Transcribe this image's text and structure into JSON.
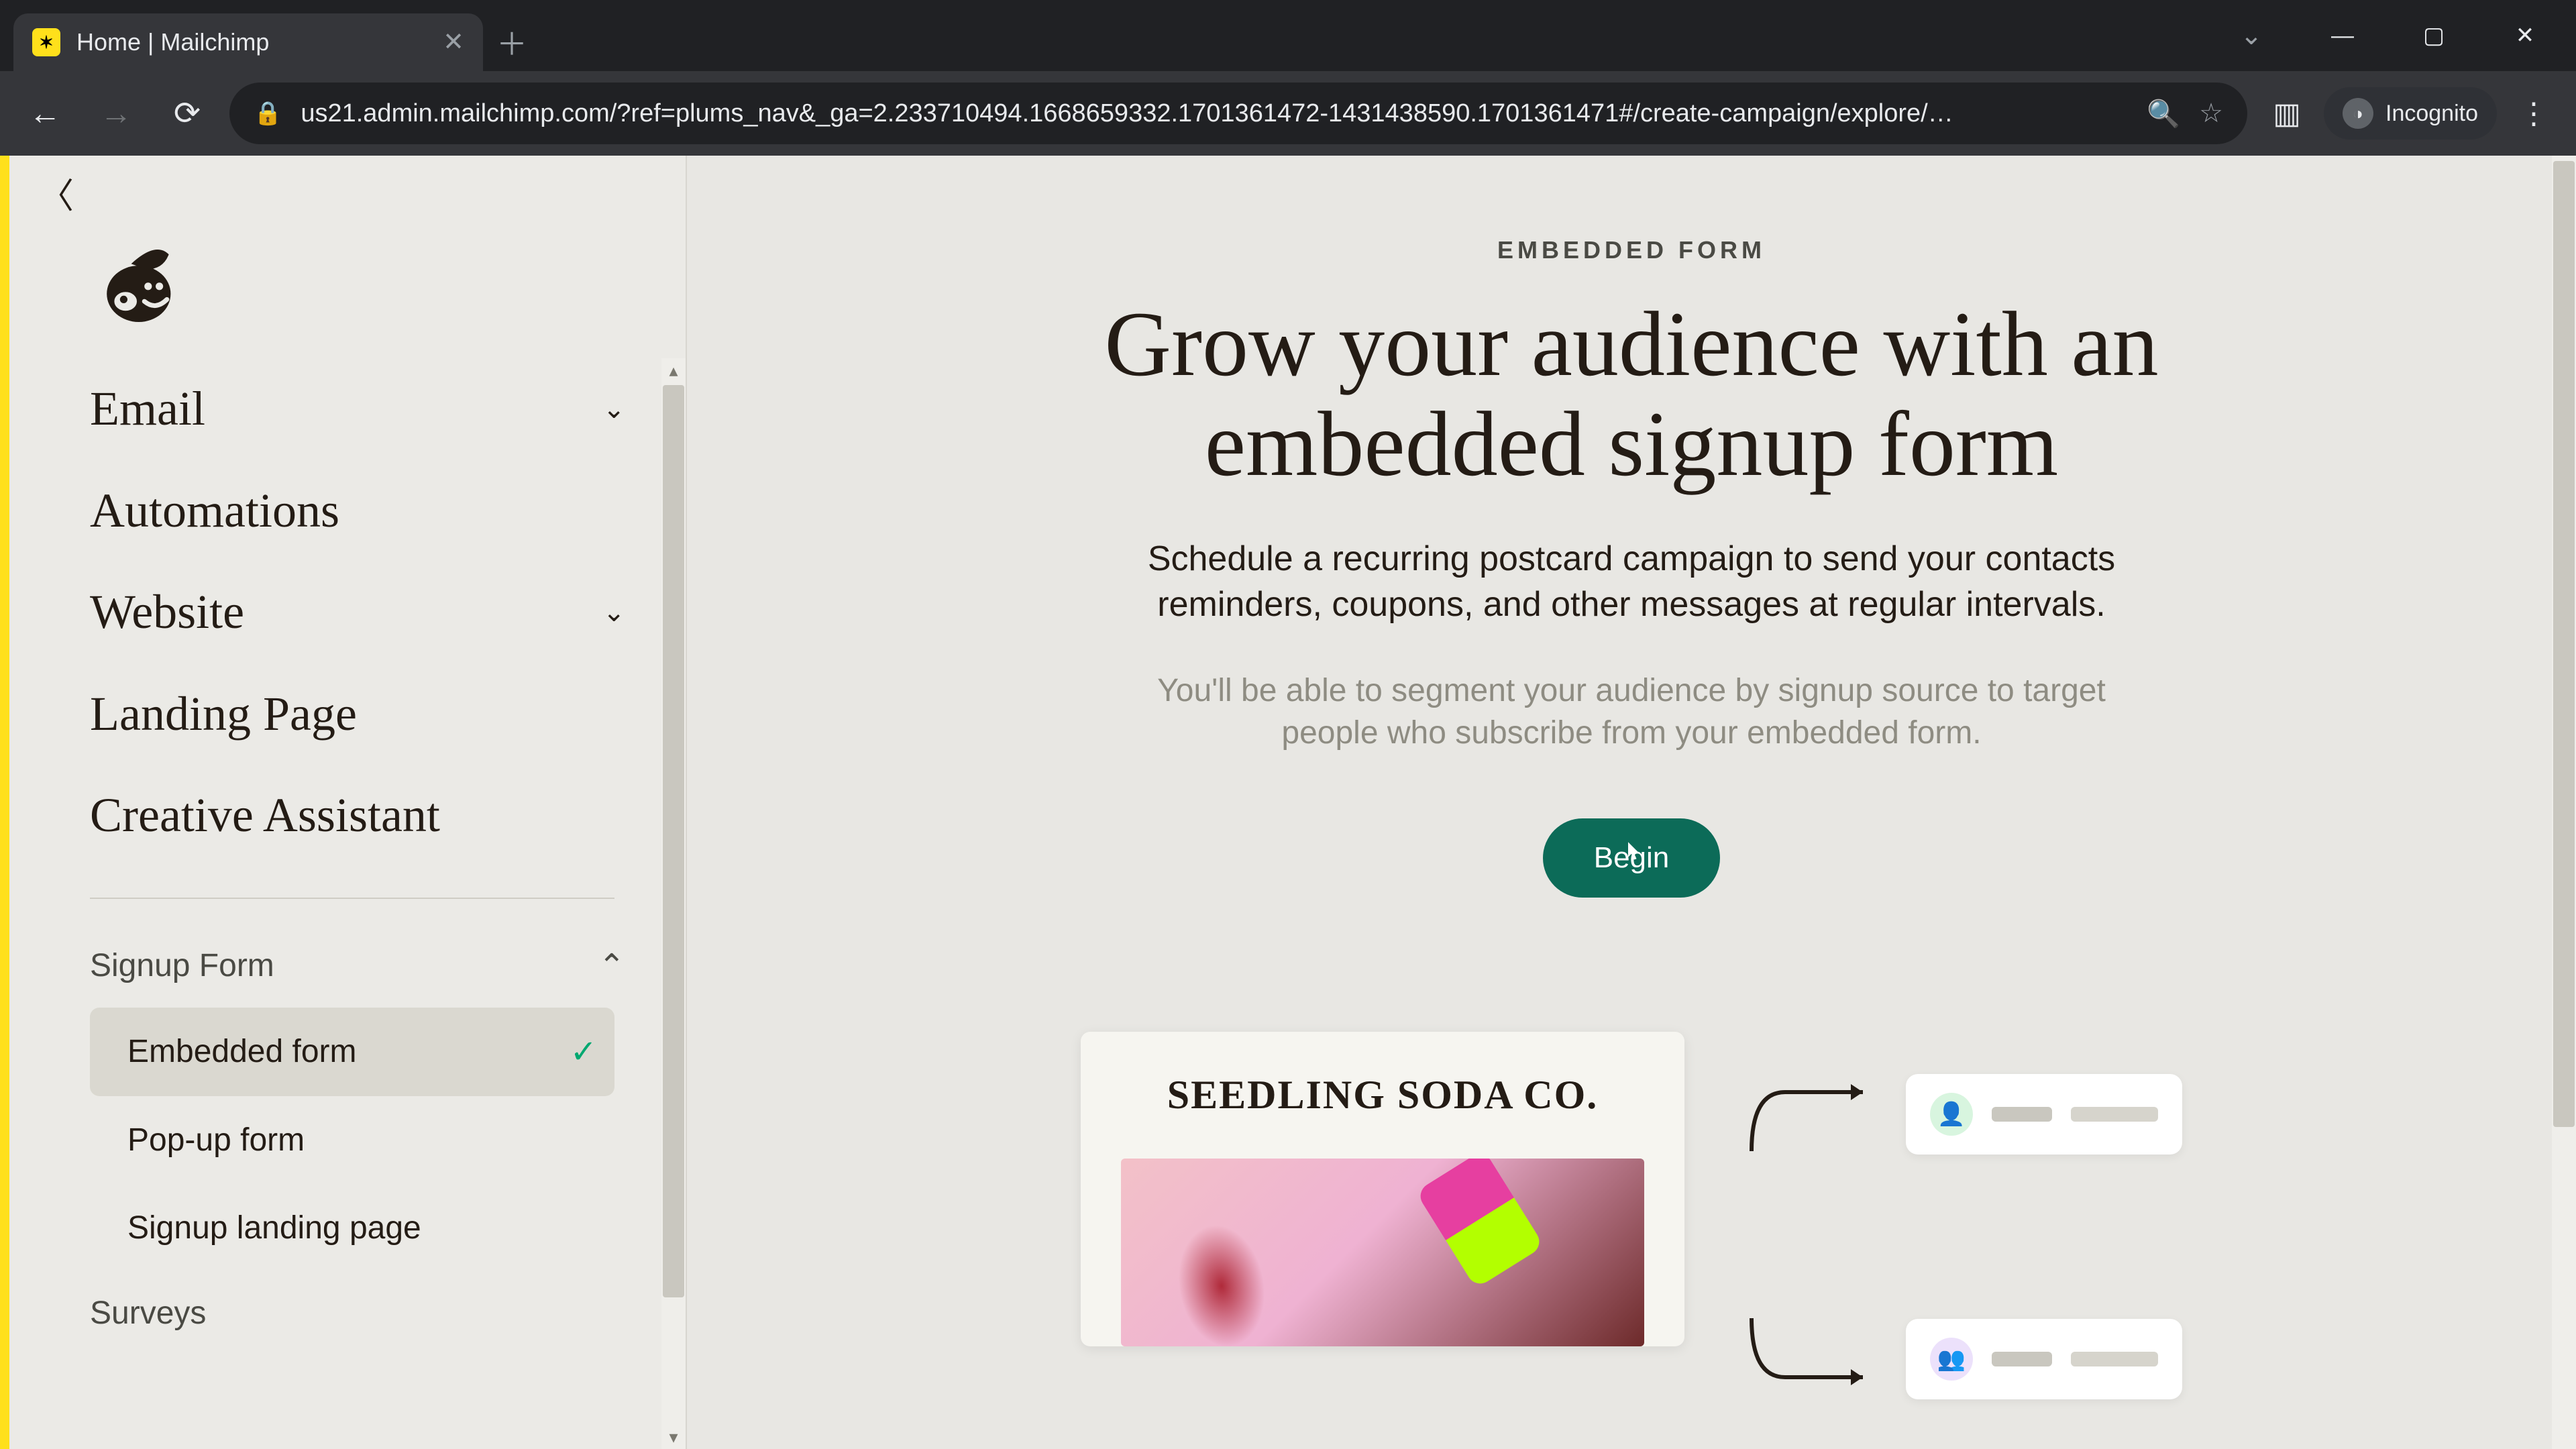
{
  "browser": {
    "tab_title": "Home | Mailchimp",
    "url": "us21.admin.mailchimp.com/?ref=plums_nav&_ga=2.233710494.1668659332.1701361472-1431438590.1701361471#/create-campaign/explore/…",
    "incognito_label": "Incognito"
  },
  "sidebar": {
    "primary": [
      {
        "label": "Email",
        "expandable": true
      },
      {
        "label": "Automations",
        "expandable": false
      },
      {
        "label": "Website",
        "expandable": true
      },
      {
        "label": "Landing Page",
        "expandable": false
      },
      {
        "label": "Creative Assistant",
        "expandable": false
      }
    ],
    "signup_head": "Signup Form",
    "signup_items": [
      {
        "label": "Embedded form",
        "active": true
      },
      {
        "label": "Pop-up form",
        "active": false
      },
      {
        "label": "Signup landing page",
        "active": false
      }
    ],
    "surveys_label": "Surveys"
  },
  "hero": {
    "eyebrow": "EMBEDDED FORM",
    "title": "Grow your audience with an embedded signup form",
    "body": "Schedule a recurring postcard campaign to send your contacts reminders, coupons, and other messages at regular intervals.",
    "fine": "You'll be able to segment your audience by signup source to target people who subscribe from your embedded form.",
    "cta_label": "Begin"
  },
  "demo_card": {
    "brand": "SEEDLING SODA CO."
  }
}
